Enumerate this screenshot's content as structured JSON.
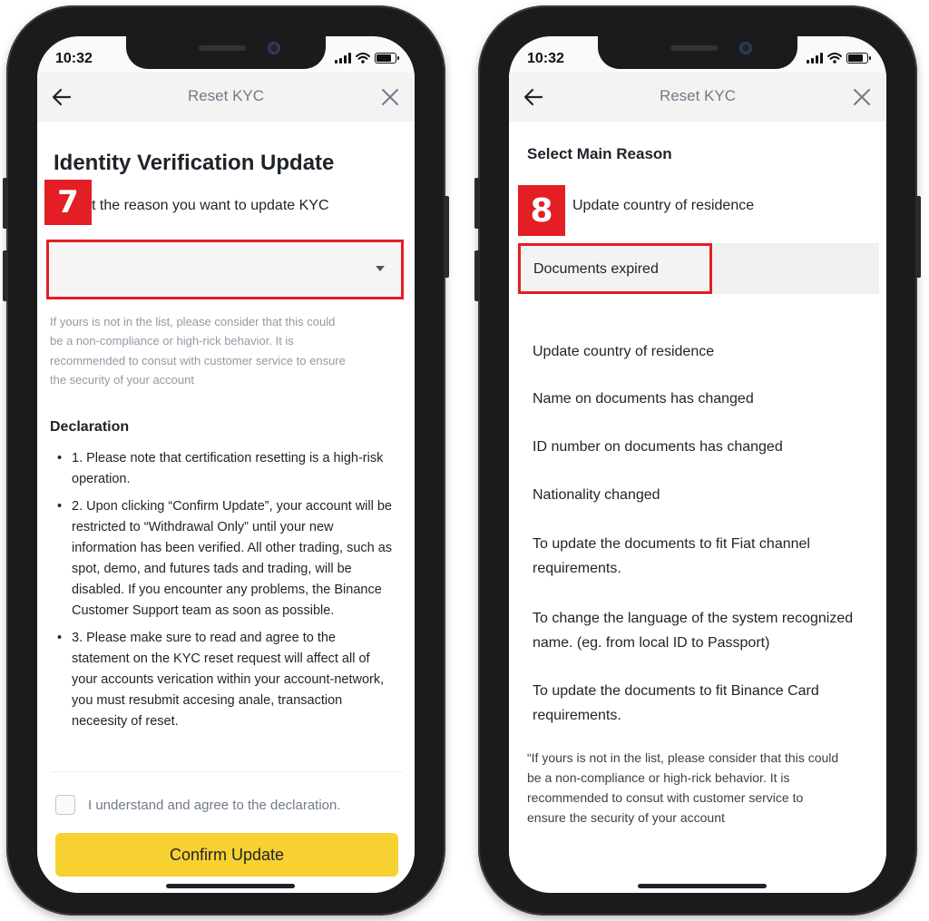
{
  "status": {
    "time": "10:32"
  },
  "left": {
    "header_title": "Reset KYC",
    "page_title": "Identity Verification Update",
    "step_badge": "7",
    "select_label": "t the reason you want to update KYC",
    "hint_lines": [
      "If yours is not in the list, please consider that this could",
      "be a non-compliance or high-rick behavior. It is",
      "recommended to consut with customer service to ensure",
      "the security of your account"
    ],
    "declaration_title": "Declaration",
    "declaration_items": [
      "1. Please note that certification resetting is a high-risk operation.",
      "2. Upon clicking “Confirm Update”, your account will be restricted to “Withdrawal Only” until your new information has been verified. All other trading, such as spot, demo, and futures tads and trading, will be disabled. If you encounter any problems, the Binance Customer Support team as soon as possible.",
      "3. Please make sure to read and agree to the statement on the KYC reset request will affect all of your accounts verication within your account-network, you must resubmit accesing anale, transaction neceesity of reset."
    ],
    "agree_text": "I understand and agree to the declaration.",
    "confirm_label": "Confirm Update"
  },
  "right": {
    "header_title": "Reset KYC",
    "section_title": "Select Main Reason",
    "step_badge": "8",
    "first_option": "Update country of residence",
    "highlighted_option": "Documents expired",
    "options": [
      "Update country of residence",
      "Name on documents has changed",
      "ID number on documents has changed",
      "Nationality changed",
      "To update the documents to fit Fiat channel requirements.",
      "To change the language of the system recognized name. (eg. from local ID to Passport)",
      "To update the documents to fit Binance Card requirements."
    ],
    "note_lines": [
      "“If yours is not in the list, please consider that this could",
      "be a non-compliance or high-rick behavior. It is",
      "recommended to consut with customer service to",
      "ensure the security of your account"
    ]
  },
  "colors": {
    "accent_yellow": "#f6d131",
    "highlight_red": "#e31e24",
    "text_primary": "#1e2329",
    "text_secondary": "#707a8a"
  },
  "icons": [
    "back-arrow-icon",
    "close-icon",
    "caret-down-icon",
    "signal-icon",
    "wifi-icon",
    "battery-icon"
  ]
}
